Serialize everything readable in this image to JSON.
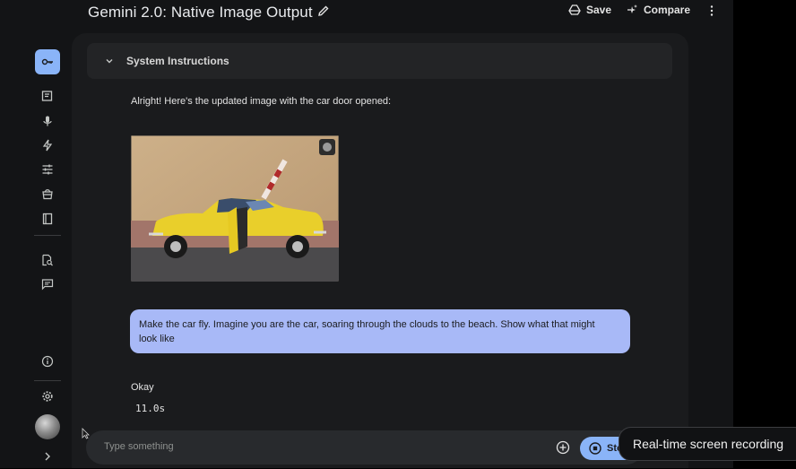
{
  "header": {
    "title": "Gemini 2.0: Native Image Output",
    "save_label": "Save",
    "compare_label": "Compare"
  },
  "sidebar": {
    "items": [
      {
        "icon": "key-icon",
        "active": true
      },
      {
        "icon": "new-chat-icon"
      },
      {
        "icon": "microphone-icon"
      },
      {
        "icon": "bolt-icon"
      },
      {
        "icon": "tune-icon"
      },
      {
        "icon": "library-icon"
      },
      {
        "icon": "book-icon"
      },
      {
        "icon": "document-search-icon"
      },
      {
        "icon": "chat-history-icon"
      },
      {
        "icon": "info-icon"
      },
      {
        "icon": "settings-icon"
      },
      {
        "icon": "expand-icon"
      }
    ]
  },
  "system_instructions": {
    "label": "System Instructions"
  },
  "chat": {
    "model_message_1": "Alright! Here's the updated image with the car door opened:",
    "user_message": "Make the car fly. Imagine you are the car, soaring through the clouds to the beach. Show what that might look like",
    "model_message_2": "Okay",
    "elapsed": "11.0s"
  },
  "input": {
    "placeholder": "Type something",
    "stop_label": "Stop"
  },
  "toast": {
    "text": "Real-time screen recording"
  },
  "colors": {
    "accent": "#8ab4f8",
    "user_bubble": "#a8b9f7",
    "background": "#131416",
    "panel": "#1a1b1d"
  }
}
